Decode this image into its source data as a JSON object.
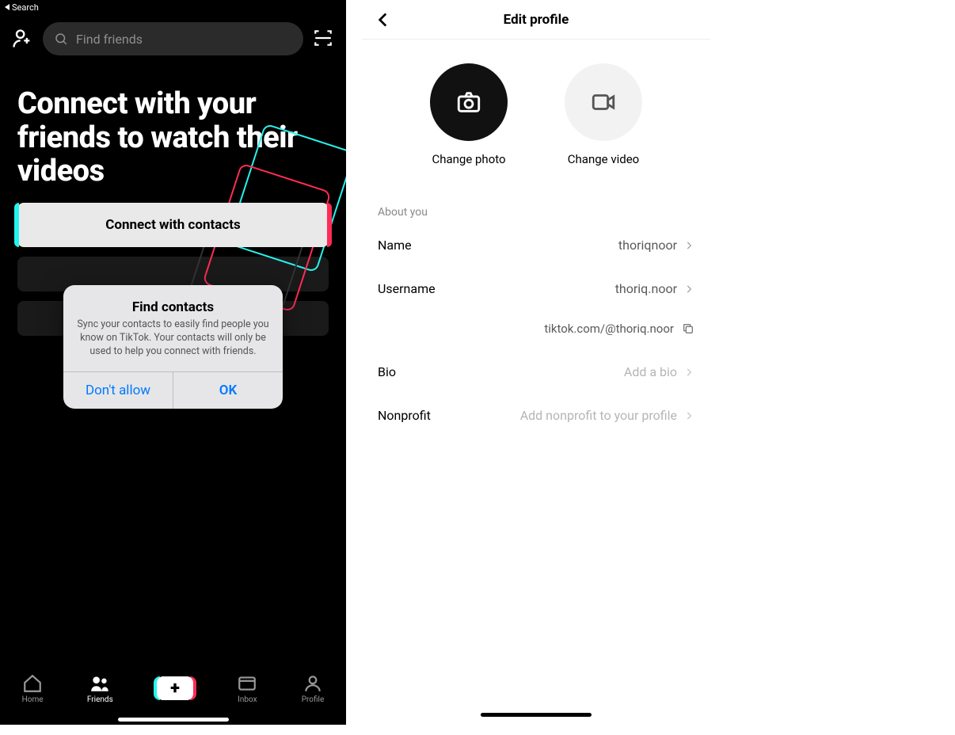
{
  "left": {
    "status_back": "Search",
    "search_placeholder": "Find friends",
    "hero_text": "Connect with your friends to watch their videos",
    "connect_button": "Connect with contacts",
    "dialog": {
      "title": "Find contacts",
      "message": "Sync your contacts to easily find people you know on TikTok. Your contacts will only be used to help you connect with friends.",
      "deny": "Don't allow",
      "allow": "OK"
    },
    "nav": {
      "home": "Home",
      "friends": "Friends",
      "inbox": "Inbox",
      "profile": "Profile"
    }
  },
  "right": {
    "header": "Edit profile",
    "change_photo": "Change photo",
    "change_video": "Change video",
    "section_about": "About you",
    "rows": {
      "name_label": "Name",
      "name_value": "thoriqnoor",
      "username_label": "Username",
      "username_value": "thoriq.noor",
      "url": "tiktok.com/@thoriq.noor",
      "bio_label": "Bio",
      "bio_placeholder": "Add a bio",
      "nonprofit_label": "Nonprofit",
      "nonprofit_placeholder": "Add nonprofit to your profile"
    }
  }
}
